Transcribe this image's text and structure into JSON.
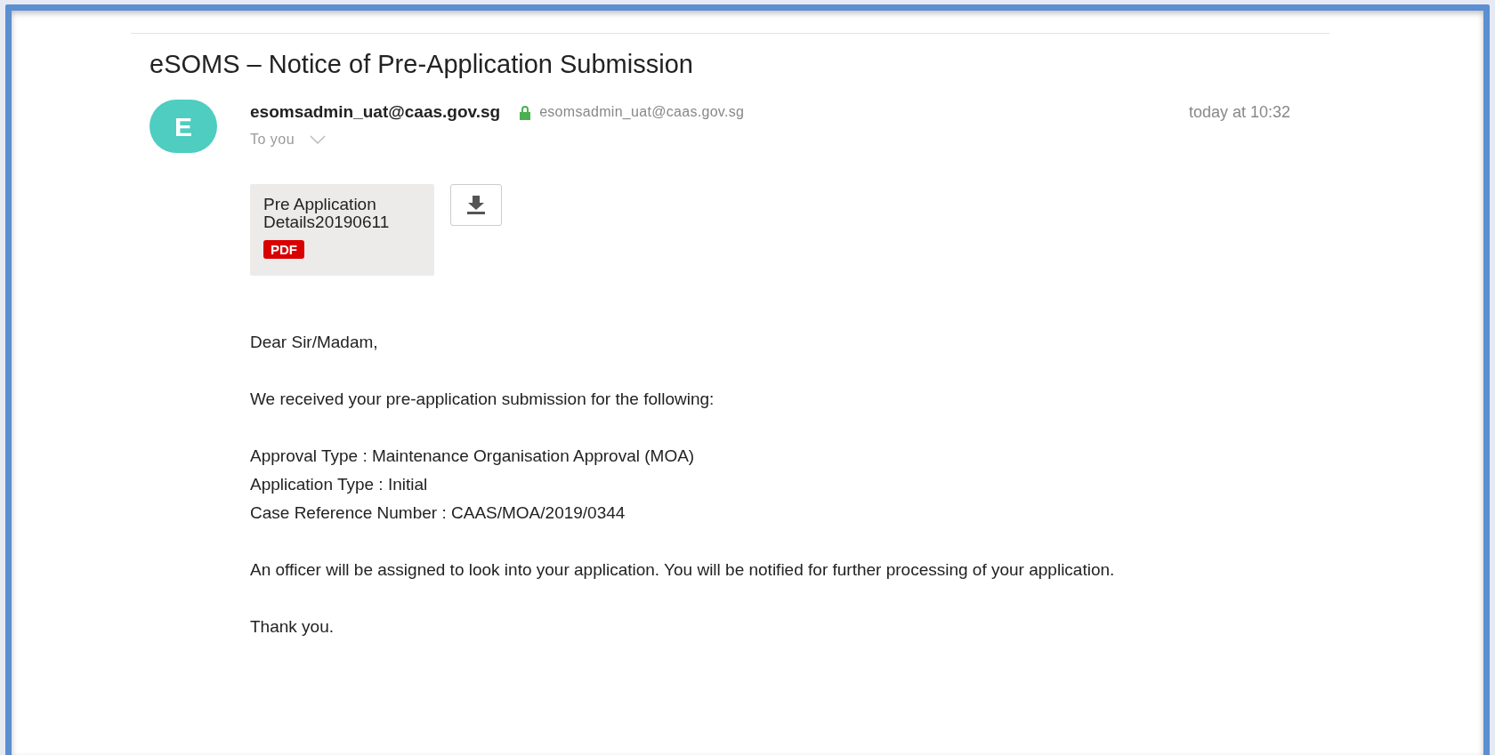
{
  "email": {
    "subject": "eSOMS – Notice of Pre-Application Submission",
    "avatar_letter": "E",
    "sender_name": "esomsadmin_uat@caas.gov.sg",
    "sender_address": "esomsadmin_uat@caas.gov.sg",
    "recipient": "To you",
    "time": "today at 10:32",
    "attachments": [
      {
        "name": "Pre Application Details20190611",
        "type": "PDF"
      }
    ],
    "body": [
      [
        "Dear Sir/Madam,"
      ],
      [
        "We received your pre-application submission for the following:"
      ],
      [
        "Approval Type : Maintenance Organisation Approval (MOA)",
        "Application Type : Initial",
        "Case Reference Number : CAAS/MOA/2019/0344"
      ],
      [
        "An officer will be assigned to look into your application. You will be notified for further processing of your application."
      ],
      [
        "Thank you."
      ]
    ]
  }
}
